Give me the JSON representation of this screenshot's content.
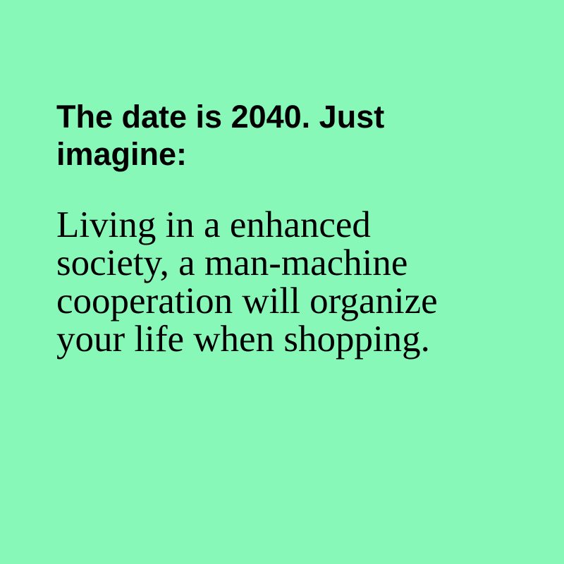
{
  "heading": {
    "lines": [
      "The date is 2040. Just",
      "imagine:"
    ]
  },
  "body": {
    "lines": [
      "Living in a enhanced",
      "society, a man-machine",
      "cooperation will organize",
      "your life when shopping."
    ]
  },
  "colors": {
    "background": "#88F8B8",
    "text": "#000000"
  }
}
